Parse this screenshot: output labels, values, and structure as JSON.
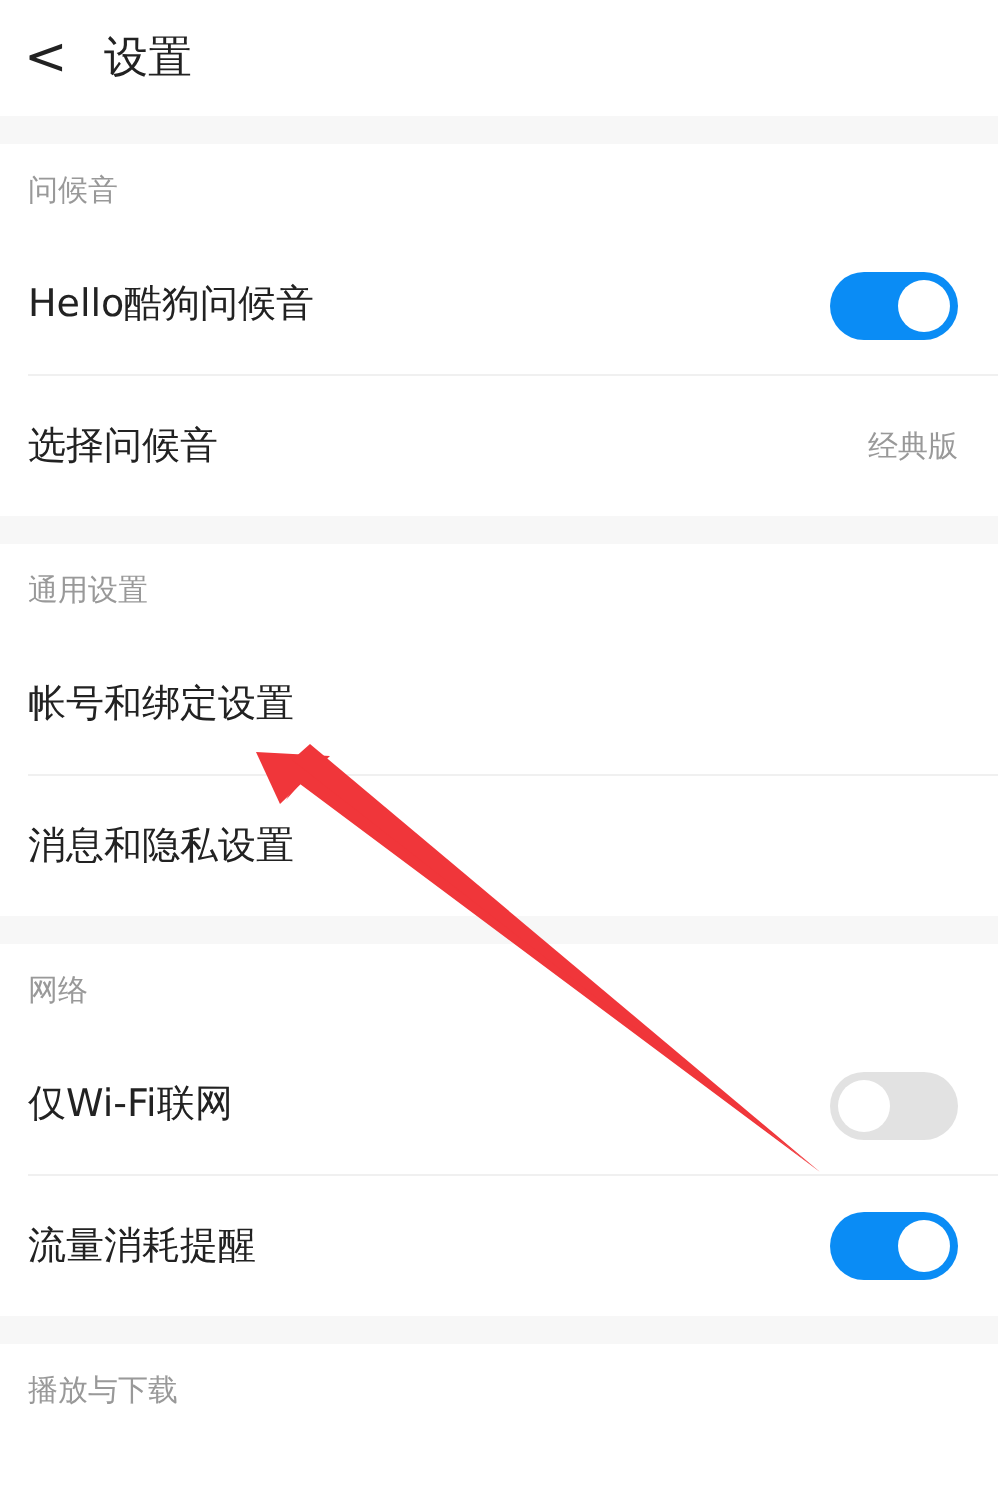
{
  "header": {
    "back": "<",
    "title": "设置"
  },
  "sections": [
    {
      "title": "问候音",
      "rows": [
        {
          "kind": "toggle",
          "label": "Hello酷狗问候音",
          "on": true
        },
        {
          "kind": "value",
          "label": "选择问候音",
          "value": "经典版"
        }
      ]
    },
    {
      "title": "通用设置",
      "rows": [
        {
          "kind": "link",
          "label": "帐号和绑定设置"
        },
        {
          "kind": "link",
          "label": "消息和隐私设置"
        }
      ]
    },
    {
      "title": "网络",
      "rows": [
        {
          "kind": "toggle",
          "label": "仅Wi-Fi联网",
          "on": false
        },
        {
          "kind": "toggle",
          "label": "流量消耗提醒",
          "on": true
        }
      ]
    },
    {
      "title": "播放与下载"
    }
  ]
}
